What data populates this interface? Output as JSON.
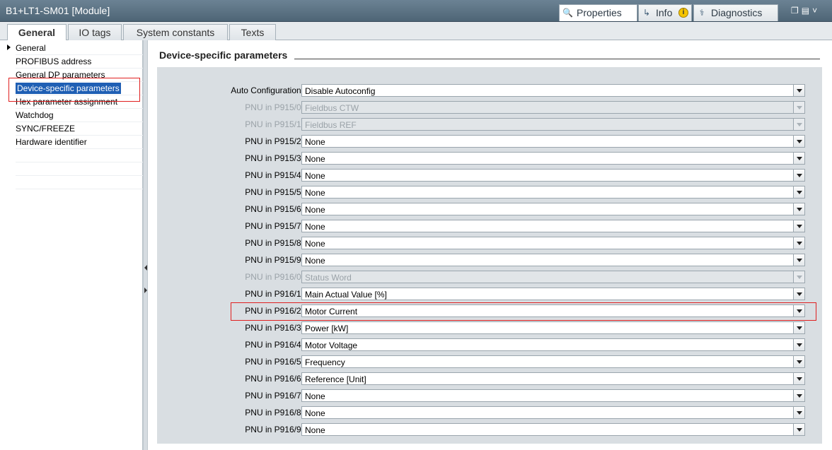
{
  "window": {
    "title": "B1+LT1-SM01 [Module]",
    "panel_tabs": [
      {
        "label": "Properties",
        "icon": "properties-icon",
        "active": true
      },
      {
        "label": "Info",
        "icon": "info-icon",
        "active": false
      },
      {
        "label": "Diagnostics",
        "icon": "diagnostics-icon",
        "active": false
      }
    ]
  },
  "subtabs": [
    "General",
    "IO tags",
    "System constants",
    "Texts"
  ],
  "nav": {
    "items": [
      {
        "label": "General",
        "expandable": true
      },
      {
        "label": "PROFIBUS address"
      },
      {
        "label": "General DP parameters"
      },
      {
        "label": "Device-specific parameters",
        "selected": true
      },
      {
        "label": "Hex parameter assignment"
      },
      {
        "label": "Watchdog"
      },
      {
        "label": "SYNC/FREEZE"
      },
      {
        "label": "Hardware identifier"
      }
    ]
  },
  "section": {
    "title": "Device-specific parameters"
  },
  "params": [
    {
      "label": "Auto Configuration:",
      "value": "Disable Autoconfig",
      "enabled": true
    },
    {
      "label": "PNU in P915/0:",
      "value": "Fieldbus CTW",
      "enabled": false
    },
    {
      "label": "PNU in P915/1:",
      "value": "Fieldbus REF",
      "enabled": false
    },
    {
      "label": "PNU in P915/2:",
      "value": "None",
      "enabled": true
    },
    {
      "label": "PNU in P915/3:",
      "value": "None",
      "enabled": true
    },
    {
      "label": "PNU in P915/4:",
      "value": "None",
      "enabled": true
    },
    {
      "label": "PNU in P915/5:",
      "value": "None",
      "enabled": true
    },
    {
      "label": "PNU in P915/6:",
      "value": "None",
      "enabled": true
    },
    {
      "label": "PNU in P915/7:",
      "value": "None",
      "enabled": true
    },
    {
      "label": "PNU in P915/8:",
      "value": "None",
      "enabled": true
    },
    {
      "label": "PNU in P915/9:",
      "value": "None",
      "enabled": true
    },
    {
      "label": "PNU in P916/0:",
      "value": "Status Word",
      "enabled": false
    },
    {
      "label": "PNU in P916/1:",
      "value": "Main Actual Value [%]",
      "enabled": true
    },
    {
      "label": "PNU in P916/2:",
      "value": "Motor Current",
      "enabled": true
    },
    {
      "label": "PNU in P916/3:",
      "value": "Power [kW]",
      "enabled": true
    },
    {
      "label": "PNU in P916/4:",
      "value": "Motor Voltage",
      "enabled": true
    },
    {
      "label": "PNU in P916/5:",
      "value": "Frequency",
      "enabled": true
    },
    {
      "label": "PNU in P916/6:",
      "value": "Reference [Unit]",
      "enabled": true
    },
    {
      "label": "PNU in P916/7:",
      "value": "None",
      "enabled": true
    },
    {
      "label": "PNU in P916/8:",
      "value": "None",
      "enabled": true
    },
    {
      "label": "PNU in P916/9:",
      "value": "None",
      "enabled": true
    }
  ]
}
